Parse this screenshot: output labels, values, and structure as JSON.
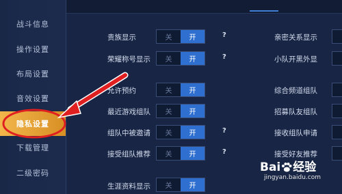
{
  "sidebar": {
    "items": [
      {
        "label": "战斗信息"
      },
      {
        "label": "操作设置"
      },
      {
        "label": "布局设置"
      },
      {
        "label": "音效设置"
      },
      {
        "label": "隐私设置"
      },
      {
        "label": "下载管理"
      },
      {
        "label": "二级密码"
      }
    ],
    "active": "隐私设置"
  },
  "toggle_labels": {
    "off": "关",
    "on": "开"
  },
  "help_symbol": "?",
  "left_rows": [
    {
      "label": "贵族显示",
      "help": true
    },
    {
      "label": "荣耀称号显示",
      "help": true
    },
    {
      "label": "允许预约",
      "help": false
    },
    {
      "label": "最近游戏组队",
      "help": false
    },
    {
      "label": "组队中被邀请",
      "help": true
    },
    {
      "label": "接受组队推荐",
      "help": true
    },
    {
      "label": "生涯资料显示",
      "help": false
    }
  ],
  "right_rows": [
    {
      "label": "亲密关系显示"
    },
    {
      "label": "小队开黑外显"
    },
    {
      "label": "综合频道组队"
    },
    {
      "label": "招募队友组队"
    },
    {
      "label": "接收组队申请"
    },
    {
      "label": "接受好友推荐"
    }
  ],
  "watermark": {
    "brand": "Bai",
    "brand2": "经验",
    "site": "jingyan.baidu.com"
  },
  "colors": {
    "accent": "#2e6fd0",
    "active_tab": "#e6a53a",
    "annotation": "#e02020"
  }
}
